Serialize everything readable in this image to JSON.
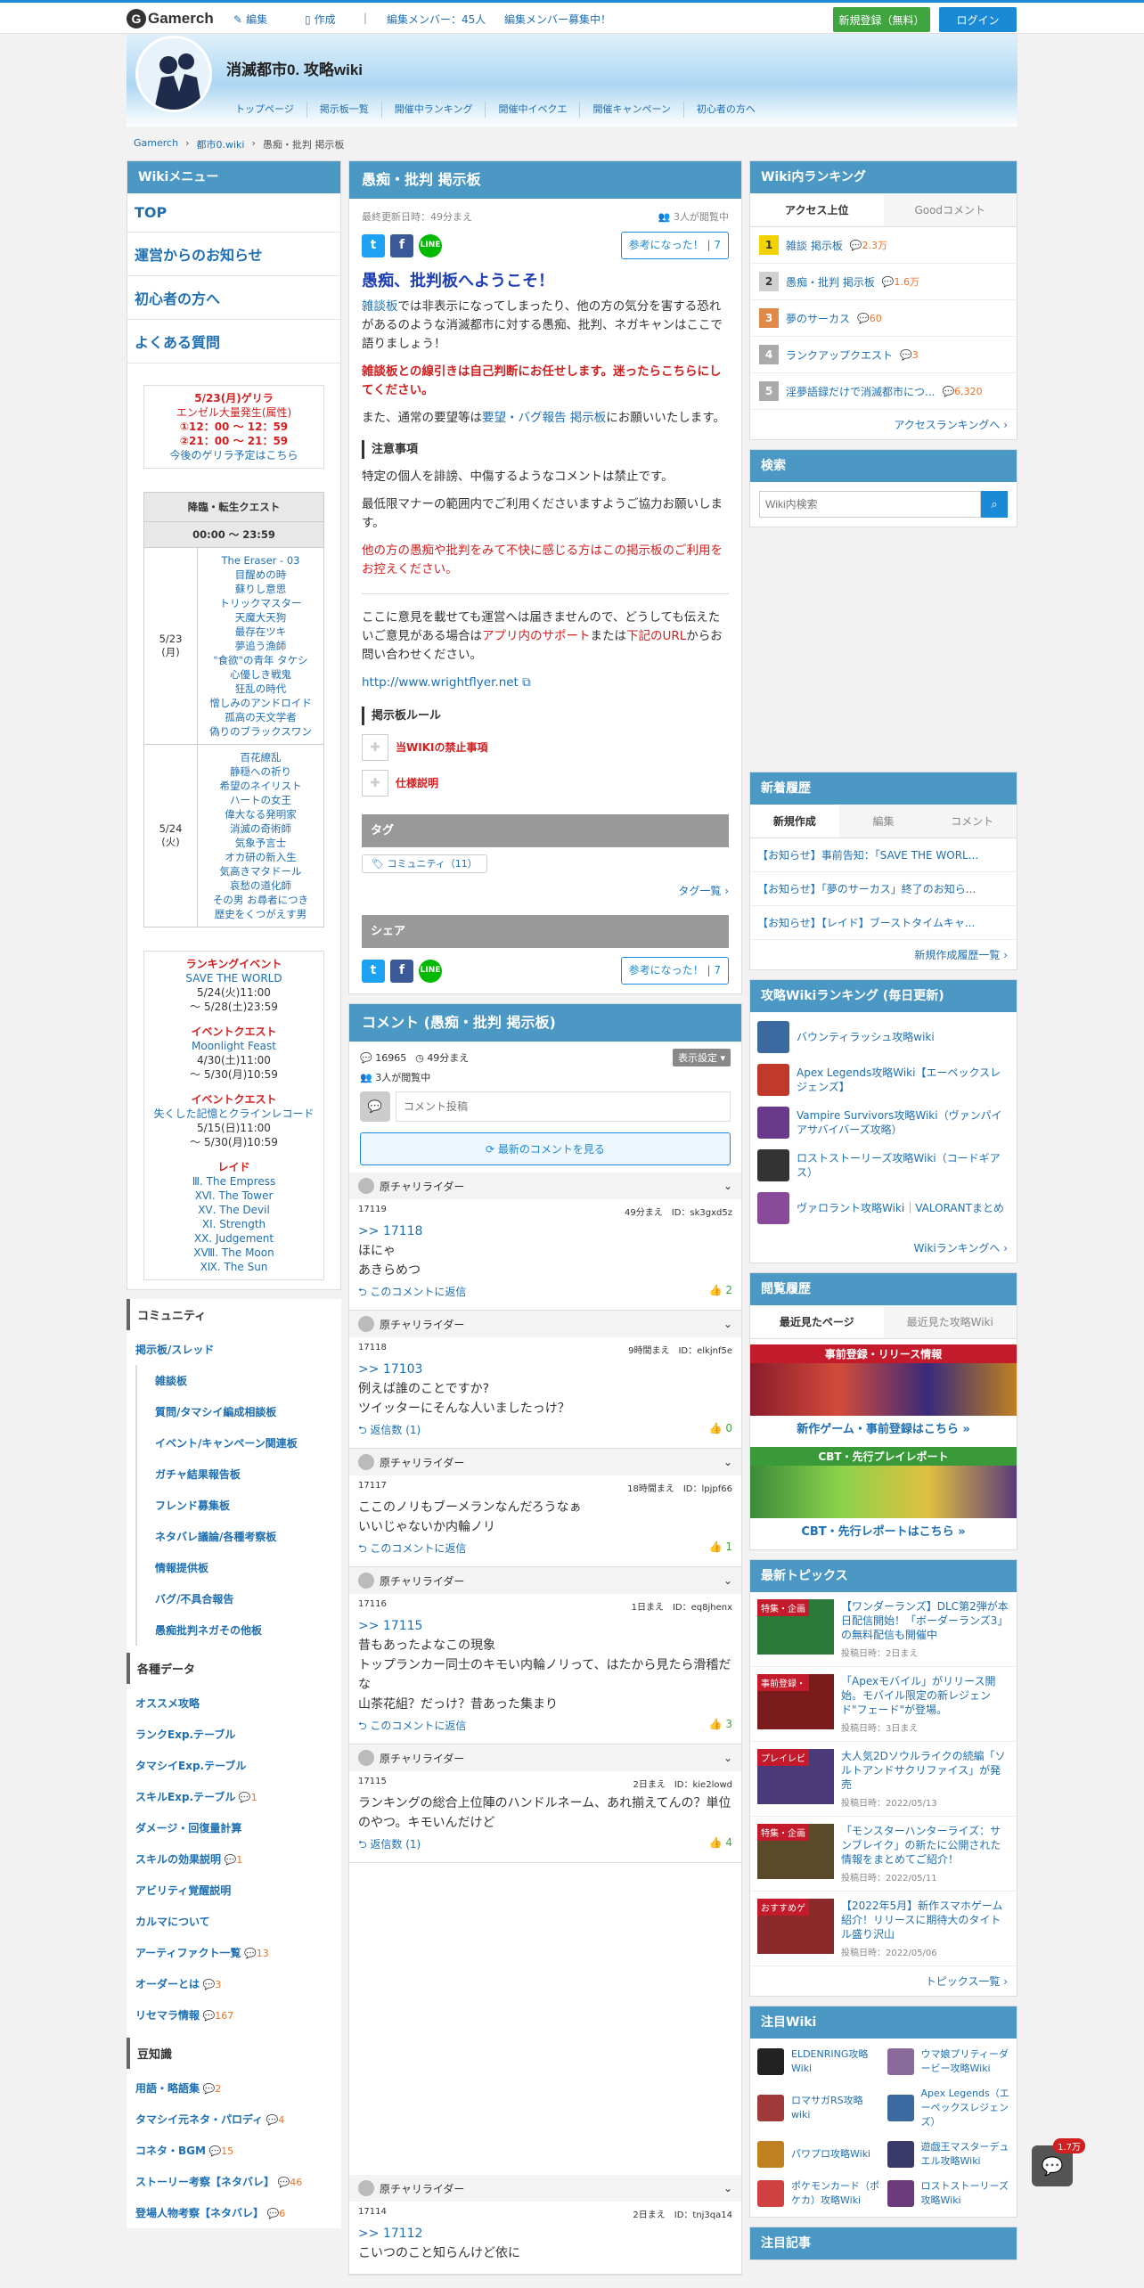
{
  "topbar": {
    "logo": "Gamerch",
    "edit": "編集",
    "create": "作成",
    "members": "編集メンバー：45人",
    "recruit": "編集メンバー募集中！",
    "register": "新規登録（無料）",
    "login": "ログイン"
  },
  "header": {
    "title": "消滅都市0. 攻略wiki",
    "nav": [
      "トップページ",
      "掲示板一覧",
      "開催中ランキング",
      "開催中イベクエ",
      "開催キャンペーン",
      "初心者の方へ"
    ]
  },
  "breadcrumb": [
    "Gamerch",
    "都市0.wiki",
    "愚痴・批判 掲示板"
  ],
  "left": {
    "menu_title": "Wikiメニュー",
    "menu": [
      "TOP",
      "運営からのお知らせ",
      "初心者の方へ",
      "よくある質問"
    ],
    "guerrilla": {
      "title": "5/23(月)ゲリラ",
      "sub": "エンゼル大量発生(属性)",
      "t1": "①12：00 ～ 12：59",
      "t2": "②21：00 ～ 21：59",
      "link": "今後のゲリラ予定はこちら"
    },
    "quest": {
      "title": "降臨・転生クエスト",
      "time": "00:00 ～ 23:59",
      "rows": [
        {
          "date": "5/23\n(月)",
          "items": [
            "The Eraser - 03",
            "目醒めの時",
            "蘇りし意思",
            "トリックマスター",
            "天魔大天狗",
            "最存在ツキ",
            "夢追う漁師",
            "\"食欲\"の青年 タケシ",
            "心優しき戦鬼",
            "狂乱の時代",
            "憎しみのアンドロイド",
            "孤高の天文学者",
            "偽りのブラックスワン"
          ]
        },
        {
          "date": "5/24\n(火)",
          "items": [
            "百花繚乱",
            "静穏への祈り",
            "希望のネイリスト",
            "ハートの女王",
            "偉大なる発明家",
            "消滅の奇術師",
            "気象予言士",
            "オカ研の新入生",
            "気高きマタドール",
            "哀愁の道化師",
            "その男 お尋者につき",
            "歴史をくつがえす男"
          ]
        }
      ]
    },
    "events": [
      {
        "kind": "ランキングイベント",
        "name": "SAVE THE WORLD",
        "from": "5/24(火)11:00",
        "to": "～ 5/28(土)23:59"
      },
      {
        "kind": "イベントクエスト",
        "name": "Moonlight Feast",
        "from": "4/30(土)11:00",
        "to": "～ 5/30(月)10:59"
      },
      {
        "kind": "イベントクエスト",
        "name": "失くした記憶とクラインレコード",
        "from": "5/15(日)11:00",
        "to": "～ 5/30(月)10:59"
      }
    ],
    "raid": {
      "kind": "レイド",
      "items": [
        "Ⅲ. The Empress",
        "ⅩⅥ. The Tower",
        "ⅩⅤ. The Devil",
        "ⅩⅠ. Strength",
        "ⅩⅩ. Judgement",
        "ⅩⅧ. The Moon",
        "ⅩⅨ. The Sun"
      ]
    },
    "community_title": "コミュニティ",
    "community": [
      {
        "t": "掲示板/スレッド",
        "sub": false
      },
      {
        "t": "雑談板",
        "sub": true
      },
      {
        "t": "質問/タマシイ編成相談板",
        "sub": true
      },
      {
        "t": "イベント/キャンペーン関連板",
        "sub": true
      },
      {
        "t": "ガチャ結果報告板",
        "sub": true
      },
      {
        "t": "フレンド募集板",
        "sub": true
      },
      {
        "t": "ネタバレ議論/各種考察板",
        "sub": true
      },
      {
        "t": "情報提供板",
        "sub": true
      },
      {
        "t": "バグ/不具合報告",
        "sub": true
      },
      {
        "t": "愚痴批判ネガその他板",
        "sub": true
      }
    ],
    "data_title": "各種データ",
    "data": [
      {
        "t": "オススメ攻略",
        "c": ""
      },
      {
        "t": "ランクExp.テーブル",
        "c": ""
      },
      {
        "t": "タマシイExp.テーブル",
        "c": ""
      },
      {
        "t": "スキルExp.テーブル",
        "c": "1"
      },
      {
        "t": "ダメージ・回復量計算",
        "c": ""
      },
      {
        "t": "スキルの効果説明",
        "c": "1"
      },
      {
        "t": "アビリティ覚醒説明",
        "c": ""
      },
      {
        "t": "カルマについて",
        "c": ""
      },
      {
        "t": "アーティファクト一覧",
        "c": "13"
      },
      {
        "t": "オーダーとは",
        "c": "3"
      },
      {
        "t": "リセマラ情報",
        "c": "167"
      }
    ],
    "trivia_title": "豆知識",
    "trivia": [
      {
        "t": "用語・略語集",
        "c": "2"
      },
      {
        "t": "タマシイ元ネタ・パロディ",
        "c": "4"
      },
      {
        "t": "コネタ・BGM",
        "c": "15"
      },
      {
        "t": "ストーリー考察【ネタバレ】",
        "c": "46"
      },
      {
        "t": "登場人物考察【ネタバレ】",
        "c": "6"
      }
    ]
  },
  "center": {
    "title": "愚痴・批判 掲示板",
    "updated": "最終更新日時：49分まえ",
    "viewers": "3人が閲覧中",
    "helpful": "参考になった！",
    "helpful_count": "7",
    "welcome": "愚痴、批判板へようこそ！",
    "p1_link": "雑談板",
    "p1": "では非表示になってしまったり、他の方の気分を害する恐れがあるのような消滅都市に対する愚痴、批判、ネガキャンはここで語りましょう！",
    "warn": "雑談板との線引きは自己判断にお任せします。迷ったらこちらにしてください。",
    "p2a": "また、通常の要望等は",
    "p2_link": "要望・バグ報告 掲示板",
    "p2b": "にお願いいたします。",
    "notice_title": "注意事項",
    "n1": "特定の個人を誹謗、中傷するようなコメントは禁止です。",
    "n2": "最低限マナーの範囲内でご利用くださいますようご協力お願いします。",
    "n3": "他の方の愚痴や批判をみて不快に感じる方はこの掲示板のご利用をお控えください。",
    "p3a": "ここに意見を載せても運営へは届きませんので、どうしても伝えたいご意見がある場合は",
    "p3_link1": "アプリ内のサポート",
    "p3b": "または",
    "p3_link2": "下記のURL",
    "p3c": "からお問い合わせください。",
    "url": "http://www.wrightflyer.net",
    "rule_title": "掲示板ルール",
    "rules": [
      "当WIKIの禁止事項",
      "仕様説明"
    ],
    "tag_title": "タグ",
    "tag": "コミュニティ（11）",
    "tag_list": "タグ一覧",
    "share_title": "シェア",
    "comments_title": "コメント (愚痴・批判 掲示板)",
    "count": "16965",
    "since": "49分まえ",
    "display": "表示設定",
    "placeholder": "コメント投稿",
    "latest_btn": "最新のコメントを見る",
    "comments": [
      {
        "name": "原チャリライダー",
        "no": "17119",
        "time": "49分まえ",
        "id": "ID：sk3gxd5z",
        "anchor": ">> 17118",
        "lines": [
          "ほにゃ",
          "あきらめつ"
        ],
        "reply": "このコメントに返信",
        "good": "2"
      },
      {
        "name": "原チャリライダー",
        "no": "17118",
        "time": "9時間まえ",
        "id": "ID：elkjnf5e",
        "anchor": ">> 17103",
        "lines": [
          "例えば誰のことですか?",
          "ツイッターにそんな人いましたっけ？"
        ],
        "reply": "返信数 (1)",
        "good": "0"
      },
      {
        "name": "原チャリライダー",
        "no": "17117",
        "time": "18時間まえ",
        "id": "ID：lpjpf66",
        "anchor": "",
        "lines": [
          "ここのノリもブーメランなんだろうなぁ",
          "いいじゃないか内輪ノリ"
        ],
        "reply": "このコメントに返信",
        "good": "1"
      },
      {
        "name": "原チャリライダー",
        "no": "17116",
        "time": "1日まえ",
        "id": "ID：eq8jhenx",
        "anchor": ">> 17115",
        "lines": [
          "昔もあったよなこの現象",
          "トップランカー同士のキモい内輪ノリって、はたから見たら滑稽だな",
          "山茶花組？だっけ？昔あった集まり"
        ],
        "reply": "このコメントに返信",
        "good": "3"
      },
      {
        "name": "原チャリライダー",
        "no": "17115",
        "time": "2日まえ",
        "id": "ID：kie2lowd",
        "anchor": "",
        "lines": [
          "ランキングの総合上位陣のハンドルネーム、あれ揃えてんの？単位のやつ。キモいんだけど"
        ],
        "reply": "返信数 (1)",
        "good": "4"
      }
    ],
    "last_comment": {
      "name": "原チャリライダー",
      "no": "17114",
      "time": "2日まえ",
      "id": "ID：tnj3qa14",
      "anchor": ">> 17112",
      "line": "こいつのこと知らんけど依に"
    }
  },
  "right": {
    "rank_title": "Wiki内ランキング",
    "rank_tabs": [
      "アクセス上位",
      "Goodコメント"
    ],
    "ranks": [
      {
        "n": "1",
        "t": "雑談 掲示板",
        "c": "2.3万"
      },
      {
        "n": "2",
        "t": "愚痴・批判 掲示板",
        "c": "1.6万"
      },
      {
        "n": "3",
        "t": "夢のサーカス",
        "c": "60"
      },
      {
        "n": "4",
        "t": "ランクアップクエスト",
        "c": "3"
      },
      {
        "n": "5",
        "t": "淫夢語録だけで消滅都市につ...",
        "c": "6,320"
      }
    ],
    "rank_more": "アクセスランキングへ",
    "search_title": "検索",
    "search_ph": "Wiki内検索",
    "new_title": "新着履歴",
    "new_tabs": [
      "新規作成",
      "編集",
      "コメント"
    ],
    "new_items": [
      "【お知らせ】事前告知：「SAVE THE WORL...",
      "【お知らせ】「夢のサーカス」終了のお知ら...",
      "【お知らせ】【レイド】ブーストタイムキャ..."
    ],
    "new_more": "新規作成履歴一覧",
    "wiki_title": "攻略Wikiランキング (毎日更新)",
    "wikis": [
      "バウンティラッシュ攻略wiki",
      "Apex Legends攻略Wiki【エーペックスレジェンズ】",
      "Vampire Survivors攻略Wiki（ヴァンパイアサバイバーズ攻略）",
      "ロストストーリーズ攻略Wiki（コードギアス）",
      "ヴァロラント攻略Wiki｜VALORANTまとめ"
    ],
    "wiki_more": "Wikiランキングへ",
    "view_title": "閲覧履歴",
    "view_tabs": [
      "最近見たページ",
      "最近見た攻略Wiki"
    ],
    "banner1_top": "事前登録・リリース情報",
    "banner1": "新作ゲーム・事前登録はこちら",
    "banner2_top": "CBT・先行プレイレポート",
    "banner2": "CBT・先行レポートはこちら",
    "topics_title": "最新トピックス",
    "topics": [
      {
        "tag": "特集・企画",
        "t": "【ワンダーランズ】DLC第2弾が本日配信開始！「ボーダーランズ3」の無料配信も開催中",
        "d": "投稿日時：2日まえ",
        "c": "#2c7a3a"
      },
      {
        "tag": "事前登録・",
        "t": "「Apexモバイル」がリリース開始。モバイル限定の新レジェンド\"フェード\"が登場。",
        "d": "投稿日時：3日まえ",
        "c": "#7a1c1c"
      },
      {
        "tag": "プレイレビ",
        "t": "大人気2Dソウルライクの続編「ソルトアンドサクリファイス」が発売",
        "d": "投稿日時：2022/05/13",
        "c": "#4a3a7a"
      },
      {
        "tag": "特集・企画",
        "t": "「モンスターハンターライズ：サンブレイク」の新たに公開された情報をまとめてご紹介！",
        "d": "投稿日時：2022/05/11",
        "c": "#5a4a2a"
      },
      {
        "tag": "おすすめゲ",
        "t": "【2022年5月】新作スマホゲーム紹介！リリースに期待大のタイトル盛り沢山",
        "d": "投稿日時：2022/05/06",
        "c": "#8a2a2a"
      }
    ],
    "topics_more": "トピックス一覧",
    "focus_title": "注目Wiki",
    "focus": [
      "ELDENRING攻略Wiki",
      "ウマ娘プリティーダービー攻略Wiki",
      "ロマサガRS攻略wiki",
      "Apex Legends（エーペックスレジェンズ）",
      "パワプロ攻略Wiki",
      "遊戯王マスターデュエル攻略Wiki",
      "ポケモンカード（ポケカ）攻略Wiki",
      "ロストストーリーズ攻略Wiki"
    ],
    "focus_articles_title": "注目記事",
    "bubble_count": "1.7万"
  },
  "colors": {
    "accent": "#4b98c5",
    "link": "#1f6fb3",
    "warn": "#d21f1f",
    "green": "#3fa63f"
  }
}
